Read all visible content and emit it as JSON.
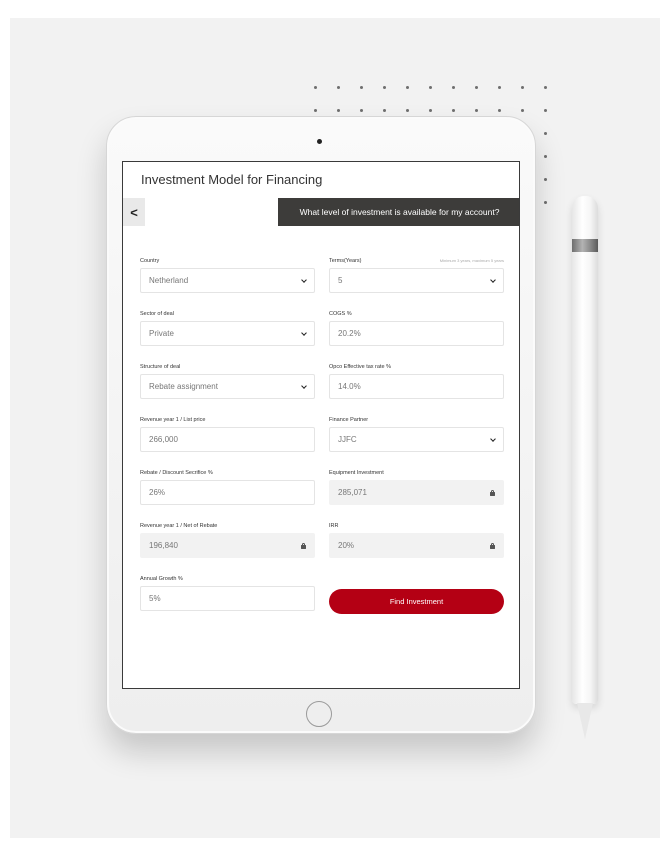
{
  "app": {
    "title": "Investment Model for Financing",
    "back_label": "<",
    "question": "What level of investment is available for my account?"
  },
  "form": {
    "country": {
      "label": "Country",
      "value": "Netherland"
    },
    "terms": {
      "label": "Terms(Years)",
      "hint": "Minimum 3 years, maximum 5 years",
      "value": "5"
    },
    "sector": {
      "label": "Sector of deal",
      "value": "Private"
    },
    "cogs": {
      "label": "COGS %",
      "value": "20.2%"
    },
    "structure": {
      "label": "Structure of deal",
      "value": "Rebate assignment"
    },
    "opco_tax": {
      "label": "Opco Effective tax rate %",
      "value": "14.0%"
    },
    "revenue_list": {
      "label": "Revenue year 1 / List price",
      "value": "266,000"
    },
    "finance_partner": {
      "label": "Finance Partner",
      "value": "JJFC"
    },
    "rebate": {
      "label": "Rebate / Discount Secrifice %",
      "value": "26%"
    },
    "equipment": {
      "label": "Equipment Investment",
      "value": "285,071"
    },
    "revenue_net": {
      "label": "Revenue year 1 / Net of Rebate",
      "value": "196,840"
    },
    "irr": {
      "label": "IRR",
      "value": "20%"
    },
    "growth": {
      "label": "Annual Growth %",
      "value": "5%"
    }
  },
  "actions": {
    "find_label": "Find Investment"
  },
  "colors": {
    "accent": "#b40014",
    "question_bg": "#3d3c3a",
    "locked_bg": "#f2f2f2"
  },
  "icons": {
    "dropdown": "chevron-down-icon",
    "locked": "lock-icon",
    "back": "back-icon"
  }
}
